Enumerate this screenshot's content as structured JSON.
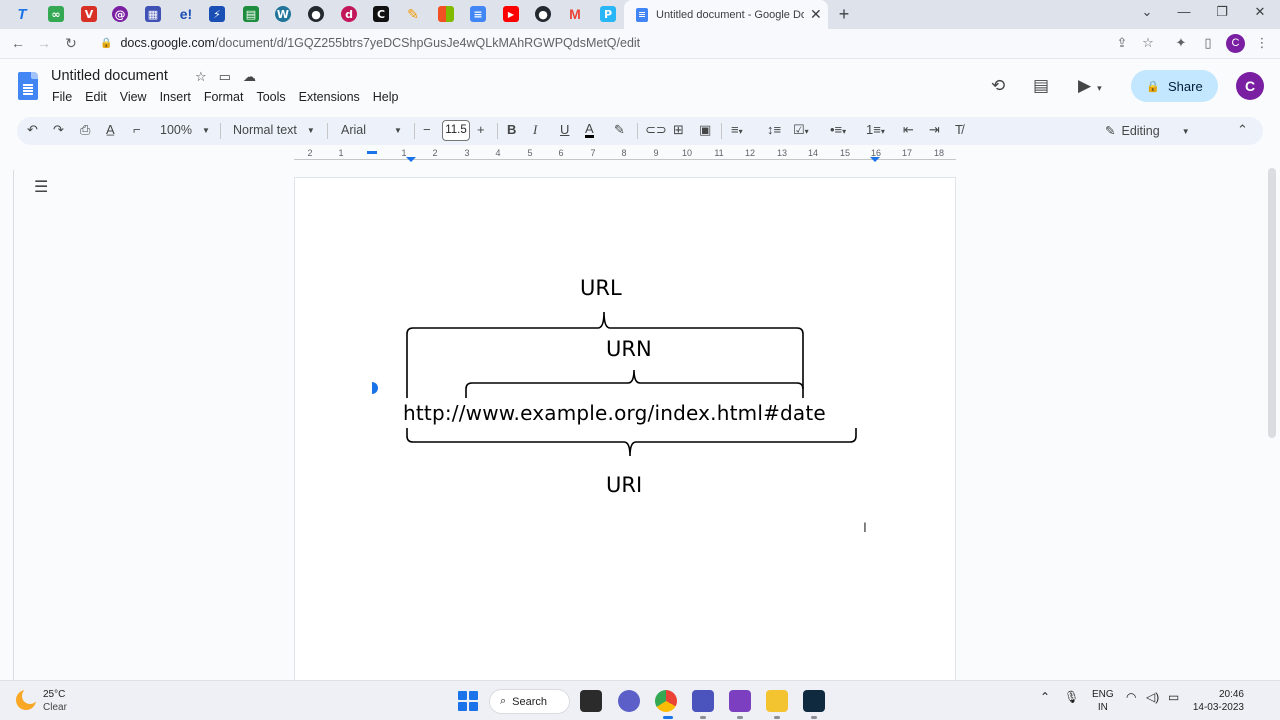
{
  "browser": {
    "active_tab_title": "Untitled document - Google Docs",
    "url_host": "docs.google.com",
    "url_path": "/document/d/1GQZ255btrs7yeDCShpGusJe4wQLkMAhRGWPQdsMetQ/edit",
    "profile_initial": "C"
  },
  "docs": {
    "title": "Untitled document",
    "menu": [
      "File",
      "Edit",
      "View",
      "Insert",
      "Format",
      "Tools",
      "Extensions",
      "Help"
    ],
    "share_label": "Share",
    "avatar_initial": "C"
  },
  "toolbar": {
    "zoom": "100%",
    "style": "Normal text",
    "font": "Arial",
    "font_size": "11.5",
    "mode": "Editing"
  },
  "ruler": {
    "numbers": [
      "2",
      "1",
      "1",
      "2",
      "3",
      "4",
      "5",
      "6",
      "7",
      "8",
      "9",
      "10",
      "11",
      "12",
      "13",
      "14",
      "15",
      "16",
      "17",
      "18"
    ]
  },
  "diagram": {
    "top_label": "URL",
    "middle_label": "URN",
    "url_text": "http://www.example.org/index.html#date",
    "bottom_label": "URI"
  },
  "taskbar": {
    "temperature": "25°C",
    "condition": "Clear",
    "search_label": "Search",
    "lang_line1": "ENG",
    "lang_line2": "IN",
    "time": "20:46",
    "date": "14-03-2023"
  }
}
